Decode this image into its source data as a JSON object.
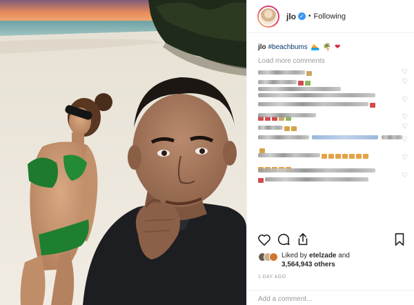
{
  "post": {
    "username": "jlo",
    "follow_status": "Following",
    "separator": "•",
    "caption_user": "jlo",
    "caption_hashtag": "#beachbums",
    "load_more": "Load more comments",
    "liked_by_prefix": "Liked by",
    "liked_by_user": "etelzade",
    "liked_by_and": "and",
    "likes_count": "3,564,943",
    "likes_others": "others",
    "time_ago": "1 DAY AGO",
    "add_comment_placeholder": "Add a comment..."
  },
  "icons": {
    "verified": "verified-badge-icon",
    "like": "heart-outline-icon",
    "comment": "comment-bubble-icon",
    "share": "share-icon",
    "save": "bookmark-icon",
    "comment_like": "small-heart-icon"
  },
  "colors": {
    "verified_blue": "#3897f0",
    "hashtag_blue": "#003569",
    "muted_gray": "#999999",
    "border_gray": "#efefef"
  }
}
